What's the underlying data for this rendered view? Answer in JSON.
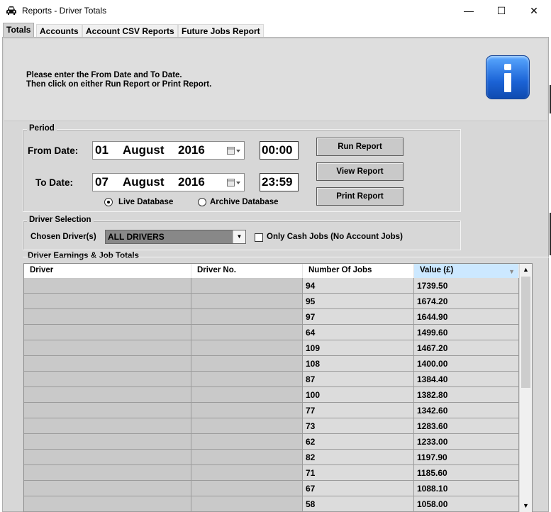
{
  "window": {
    "title": "Reports - Driver Totals",
    "icon": "car-icon",
    "minimize": "—",
    "maximize": "☐",
    "close": "✕"
  },
  "tabs": [
    {
      "label": "Totals",
      "active": true
    },
    {
      "label": "Accounts",
      "active": false
    },
    {
      "label": "Account CSV Reports",
      "active": false
    },
    {
      "label": "Future Jobs Report",
      "active": false
    }
  ],
  "info": {
    "line1": "Please enter the From Date and To Date.",
    "line2": "Then click on either Run Report or Print Report.",
    "icon": "info-icon",
    "icon_color": "#1b63d6"
  },
  "period": {
    "group_label": "Period",
    "from_label": "From Date:",
    "from_day": "01",
    "from_month": "August",
    "from_year": "2016",
    "from_time": "00:00",
    "to_label": "To Date:",
    "to_day": "07",
    "to_month": "August",
    "to_year": "2016",
    "to_time": "23:59",
    "live_label": "Live Database",
    "archive_label": "Archive Database",
    "selected_database": "Live Database"
  },
  "buttons": {
    "run": "Run Report",
    "view": "View Report",
    "print": "Print Report"
  },
  "driver_selection": {
    "group_label": "Driver Selection",
    "chosen_label": "Chosen Driver(s)",
    "selected": "ALL DRIVERS",
    "cash_only_label": "Only Cash Jobs (No Account Jobs)",
    "cash_only_checked": false
  },
  "grid": {
    "group_label": "Driver Earnings & Job Totals",
    "columns": [
      "Driver",
      "Driver No.",
      "Number Of Jobs",
      "Value (£)"
    ],
    "sorted_column": "Value (£)",
    "rows": [
      {
        "driver": "",
        "driver_no": "",
        "jobs": "94",
        "value": "1739.50"
      },
      {
        "driver": "",
        "driver_no": "",
        "jobs": "95",
        "value": "1674.20"
      },
      {
        "driver": "",
        "driver_no": "",
        "jobs": "97",
        "value": "1644.90"
      },
      {
        "driver": "",
        "driver_no": "",
        "jobs": "64",
        "value": "1499.60"
      },
      {
        "driver": "",
        "driver_no": "",
        "jobs": "109",
        "value": "1467.20"
      },
      {
        "driver": "",
        "driver_no": "",
        "jobs": "108",
        "value": "1400.00"
      },
      {
        "driver": "",
        "driver_no": "",
        "jobs": "87",
        "value": "1384.40"
      },
      {
        "driver": "",
        "driver_no": "",
        "jobs": "100",
        "value": "1382.80"
      },
      {
        "driver": "",
        "driver_no": "",
        "jobs": "77",
        "value": "1342.60"
      },
      {
        "driver": "",
        "driver_no": "",
        "jobs": "73",
        "value": "1283.60"
      },
      {
        "driver": "",
        "driver_no": "",
        "jobs": "62",
        "value": "1233.00"
      },
      {
        "driver": "",
        "driver_no": "",
        "jobs": "82",
        "value": "1197.90"
      },
      {
        "driver": "",
        "driver_no": "",
        "jobs": "71",
        "value": "1185.60"
      },
      {
        "driver": "",
        "driver_no": "",
        "jobs": "67",
        "value": "1088.10"
      },
      {
        "driver": "",
        "driver_no": "",
        "jobs": "58",
        "value": "1058.00"
      }
    ]
  }
}
